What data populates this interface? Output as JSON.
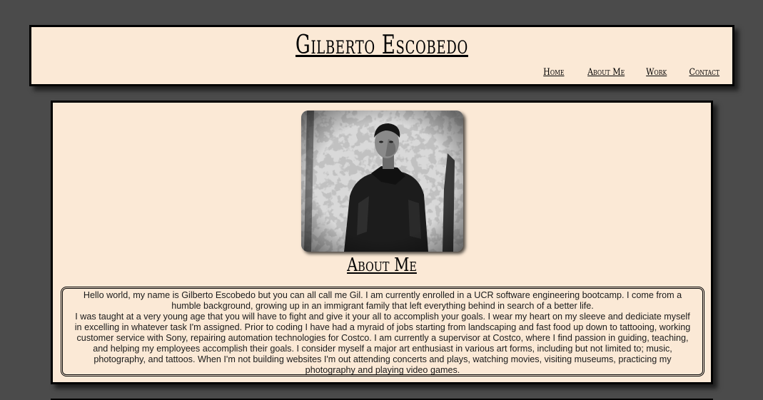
{
  "header": {
    "title": "Gilberto Escobedo",
    "nav": [
      {
        "label": "Home"
      },
      {
        "label": "About Me"
      },
      {
        "label": "Work"
      },
      {
        "label": "Contact"
      }
    ]
  },
  "main": {
    "photo_alt": "portrait photo",
    "about_heading": "About Me",
    "bio_paragraph_1": "Hello world, my name is Gilberto Escobedo but you can all call me Gil. I am currently enrolled in a UCR software engineering bootcamp. I come from a humble background, growing up in an immigrant family that left everything behind in search of a better life.",
    "bio_paragraph_2": "I was taught at a very young age that you will have to fight and give it your all to accomplish your goals. I wear my heart on my sleeve and dediciate myself in excelling in whatever task I'm assigned. Prior to coding I have had a myraid of jobs starting from landscaping and fast food up down to tattooing, working customer service with Sony, repairing automation technologies for Costco. I am currently a supervisor at Costco, where I find passion in guiding, teaching, and helping my employees accomplish their goals. I consider myself a major art enthusiast in various art forms, including but not limited to; music, photography, and tattoos. When I'm not building websites I'm out attending concerts and plays, watching movies, visiting museums, practicing my photography and playing video games."
  },
  "colors": {
    "page_background": "#4b4b4b",
    "panel_background": "#fbe9d6",
    "border": "#000000"
  }
}
